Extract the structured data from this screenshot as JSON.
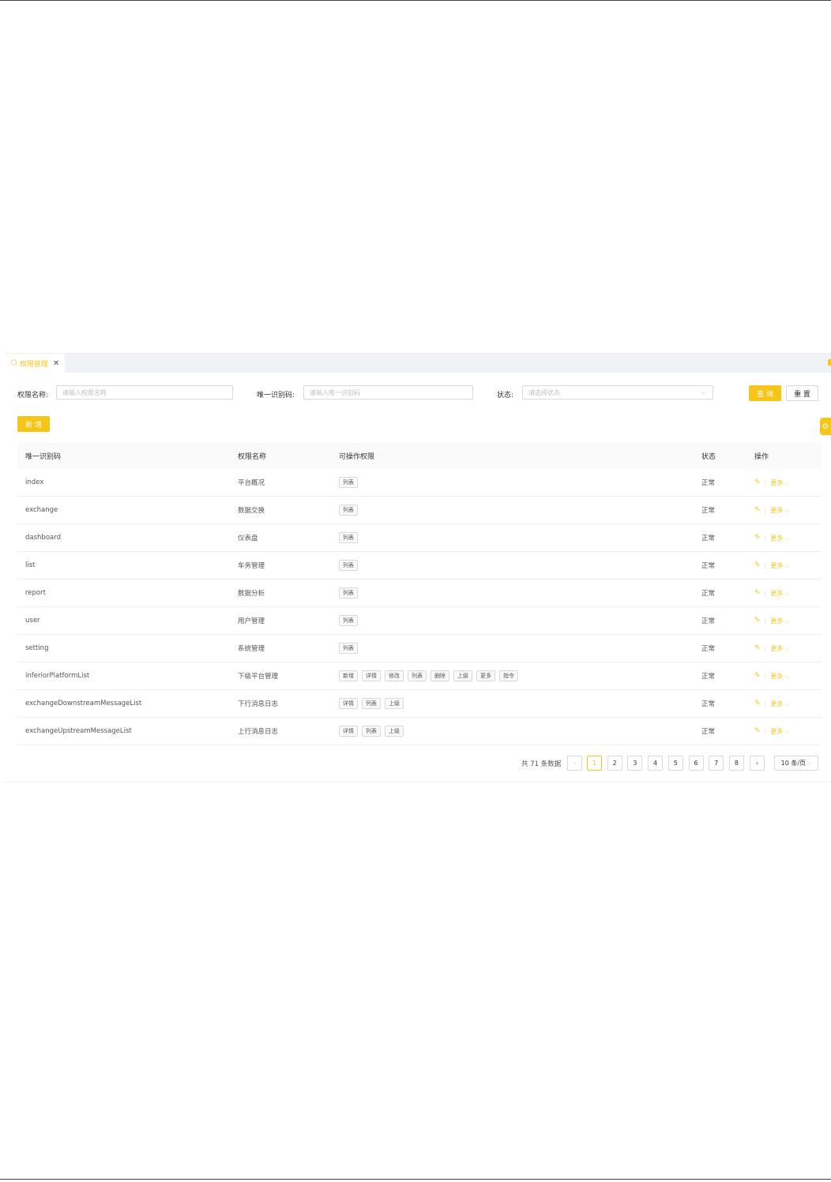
{
  "tab": {
    "icon": "cube-icon",
    "label": "权限管理"
  },
  "filters": {
    "name_label": "权限名称:",
    "name_placeholder": "请输入权限名称",
    "code_label": "唯一识别码:",
    "code_placeholder": "请输入唯一识别码",
    "status_label": "状态:",
    "status_placeholder": "请选择状态",
    "query_label": "查 询",
    "reset_label": "重 置"
  },
  "toolbar": {
    "add_label": "新 增"
  },
  "table": {
    "headers": [
      "唯一识别码",
      "权限名称",
      "可操作权限",
      "状态",
      "操作"
    ],
    "rows": [
      {
        "code": "index",
        "name": "平台概况",
        "perms": [
          "列表"
        ],
        "status": "正常"
      },
      {
        "code": "exchange",
        "name": "数据交换",
        "perms": [
          "列表"
        ],
        "status": "正常"
      },
      {
        "code": "dashboard",
        "name": "仪表盘",
        "perms": [
          "列表"
        ],
        "status": "正常"
      },
      {
        "code": "list",
        "name": "车务管理",
        "perms": [
          "列表"
        ],
        "status": "正常"
      },
      {
        "code": "report",
        "name": "数据分析",
        "perms": [
          "列表"
        ],
        "status": "正常"
      },
      {
        "code": "user",
        "name": "用户管理",
        "perms": [
          "列表"
        ],
        "status": "正常"
      },
      {
        "code": "setting",
        "name": "系统管理",
        "perms": [
          "列表"
        ],
        "status": "正常"
      },
      {
        "code": "inferiorPlatformList",
        "name": "下级平台管理",
        "perms": [
          "新增",
          "详情",
          "修改",
          "列表",
          "删除",
          "上级",
          "更多",
          "指令"
        ],
        "status": "正常"
      },
      {
        "code": "exchangeDownstreamMessageList",
        "name": "下行消息日志",
        "perms": [
          "详情",
          "列表",
          "上级"
        ],
        "status": "正常"
      },
      {
        "code": "exchangeUpstreamMessageList",
        "name": "上行消息日志",
        "perms": [
          "详情",
          "列表",
          "上级"
        ],
        "status": "正常"
      }
    ],
    "more_label": "更多"
  },
  "pagination": {
    "total_text": "共 71 条数据",
    "pages": [
      "1",
      "2",
      "3",
      "4",
      "5",
      "6",
      "7",
      "8"
    ],
    "current": "1",
    "page_size": "10 条/页"
  },
  "colors": {
    "accent": "#f5c518",
    "border": "#d9d9d9",
    "header_bg": "#fafafa",
    "tabbar_bg": "#f0f2f5"
  }
}
